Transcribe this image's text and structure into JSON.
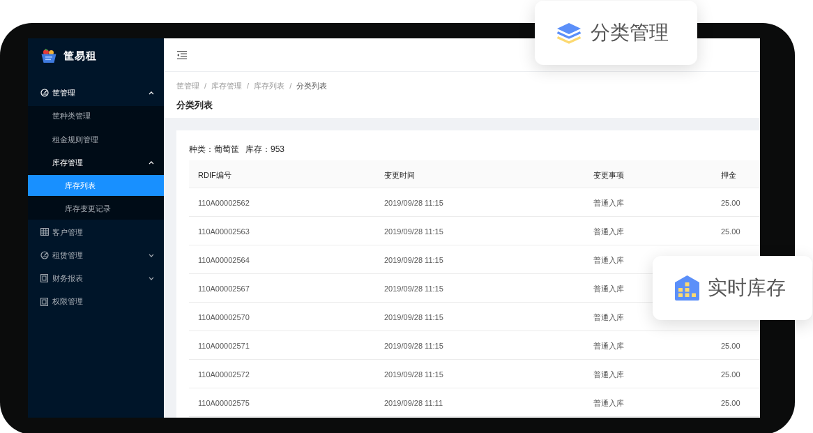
{
  "sidebar": {
    "logo": {
      "name": "筐易租"
    },
    "menu": [
      {
        "label": "筐管理",
        "kind": "submenu",
        "expanded": true,
        "children": [
          {
            "label": "筐种类管理",
            "kind": "item",
            "selected": false
          },
          {
            "label": "租金规则管理",
            "kind": "item",
            "selected": false
          },
          {
            "label": "库存管理",
            "kind": "submenu",
            "expanded": true,
            "children": [
              {
                "label": "库存列表",
                "kind": "item",
                "selected": true
              },
              {
                "label": "库存变更记录",
                "kind": "item",
                "selected": false
              }
            ]
          }
        ]
      },
      {
        "label": "客户管理",
        "kind": "item",
        "selected": false
      },
      {
        "label": "租赁管理",
        "kind": "submenu",
        "expanded": false
      },
      {
        "label": "财务报表",
        "kind": "submenu",
        "expanded": false
      },
      {
        "label": "权限管理",
        "kind": "item",
        "selected": false
      }
    ]
  },
  "breadcrumb": {
    "separator": "/",
    "items": [
      {
        "label": "筐管理",
        "current": false
      },
      {
        "label": "库存管理",
        "current": false
      },
      {
        "label": "库存列表",
        "current": false
      },
      {
        "label": "分类列表",
        "current": true
      }
    ]
  },
  "page_title": "分类列表",
  "summary": [
    "种类：葡萄筐",
    "库存：953"
  ],
  "table": {
    "columns": [
      "RDIF编号",
      "变更时间",
      "变更事项",
      "押金"
    ],
    "rows": [
      [
        "110A00002562",
        "2019/09/28 11:15",
        "普通入库",
        "25.00"
      ],
      [
        "110A00002563",
        "2019/09/28 11:15",
        "普通入库",
        "25.00"
      ],
      [
        "110A00002564",
        "2019/09/28 11:15",
        "普通入库"
      ],
      [
        "110A00002567",
        "2019/09/28 11:15",
        "普通入库"
      ],
      [
        "110A00002570",
        "2019/09/28 11:15",
        "普通入库"
      ],
      [
        "110A00002571",
        "2019/09/28 11:15",
        "普通入库",
        "25.00"
      ],
      [
        "110A00002572",
        "2019/09/28 11:15",
        "普通入库",
        "25.00"
      ],
      [
        "110A00002575",
        "2019/09/28 11:11",
        "普通入库",
        "25.00"
      ]
    ]
  },
  "callouts": [
    {
      "label": "分类管理",
      "kind": "layers"
    },
    {
      "label": "实时库存",
      "kind": "house"
    }
  ]
}
